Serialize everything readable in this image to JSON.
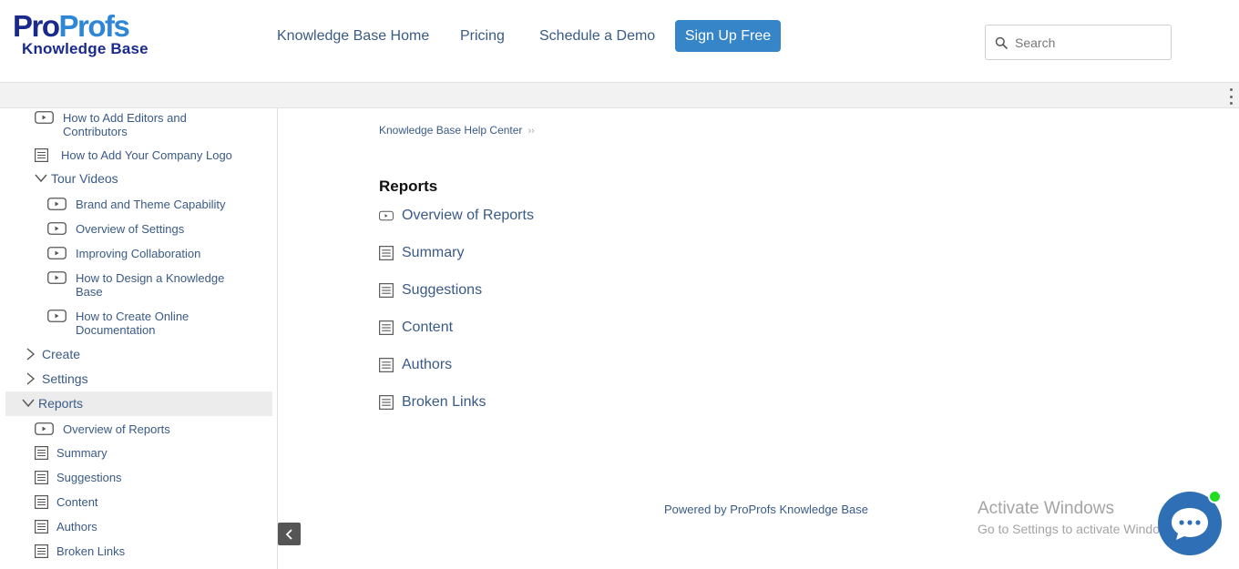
{
  "header": {
    "logo_top_pro": "Pro",
    "logo_top_profs": "Profs",
    "logo_bottom": "Knowledge Base",
    "nav": {
      "home": "Knowledge Base Home",
      "pricing": "Pricing",
      "demo": "Schedule a Demo",
      "signup": "Sign Up Free"
    },
    "search_placeholder": "Search"
  },
  "sidebar": {
    "items": [
      {
        "label": "How to Add Editors and Contributors",
        "icon": "video-icon"
      },
      {
        "label": "How to Add Your Company Logo",
        "icon": "document-icon"
      },
      {
        "label": "Tour Videos",
        "icon": "chevron-down-icon"
      },
      {
        "label": "Brand and Theme Capability",
        "icon": "video-icon"
      },
      {
        "label": "Overview of Settings",
        "icon": "video-icon"
      },
      {
        "label": "Improving Collaboration",
        "icon": "video-icon"
      },
      {
        "label": "How to Design a Knowledge Base",
        "icon": "video-icon"
      },
      {
        "label": "How to Create Online Documentation",
        "icon": "video-icon"
      },
      {
        "label": "Create",
        "icon": "chevron-right-icon"
      },
      {
        "label": "Settings",
        "icon": "chevron-right-icon"
      },
      {
        "label": "Reports",
        "icon": "chevron-down-icon"
      },
      {
        "label": "Overview of Reports",
        "icon": "video-icon"
      },
      {
        "label": "Summary",
        "icon": "document-icon"
      },
      {
        "label": "Suggestions",
        "icon": "document-icon"
      },
      {
        "label": "Content",
        "icon": "document-icon"
      },
      {
        "label": "Authors",
        "icon": "document-icon"
      },
      {
        "label": "Broken Links",
        "icon": "document-icon"
      }
    ]
  },
  "main": {
    "breadcrumb": "Knowledge Base Help Center",
    "breadcrumb_sep": "››",
    "section_title": "Reports",
    "items": [
      {
        "label": "Overview of Reports",
        "icon": "video-icon"
      },
      {
        "label": "Summary",
        "icon": "document-icon"
      },
      {
        "label": "Suggestions",
        "icon": "document-icon"
      },
      {
        "label": "Content",
        "icon": "document-icon"
      },
      {
        "label": "Authors",
        "icon": "document-icon"
      },
      {
        "label": "Broken Links",
        "icon": "document-icon"
      }
    ],
    "powered_by": "Powered by ProProfs Knowledge Base"
  },
  "watermark": {
    "line1": "Activate Windows",
    "line2": "Go to Settings to activate Windows."
  },
  "colors": {
    "link": "#3a5a86",
    "brand_dark": "#1a2a8c",
    "brand_light": "#2d86d6",
    "button": "#3785c9",
    "chat": "#2e6fb5",
    "online_dot": "#22dd22"
  }
}
